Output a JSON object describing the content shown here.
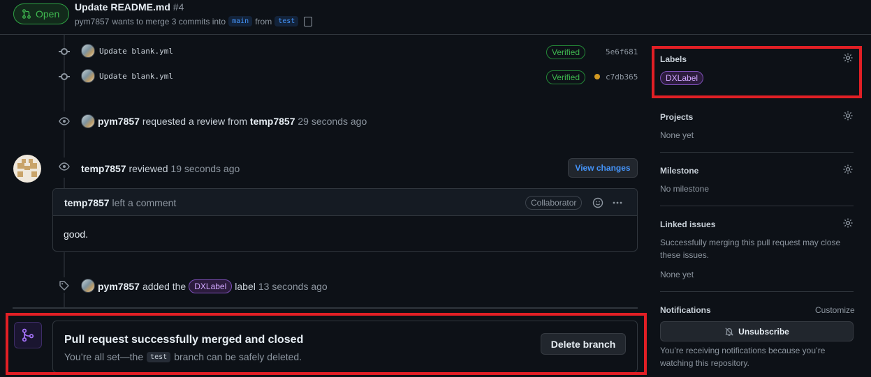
{
  "header": {
    "status": "Open",
    "title": "Update README.md",
    "number": "#4",
    "author": "pym7857",
    "merge_text": "wants to merge 3 commits into",
    "base_branch": "main",
    "from_text": "from",
    "head_branch": "test"
  },
  "commits": [
    {
      "message": "Update blank.yml",
      "badge": "Verified",
      "sha": "5e6f681"
    },
    {
      "message": "Update blank.yml",
      "badge": "Verified",
      "sha": "c7db365"
    }
  ],
  "events": {
    "review_request": {
      "actor": "pym7857",
      "text": "requested a review from",
      "target": "temp7857",
      "time": "29 seconds ago"
    },
    "review": {
      "actor": "temp7857",
      "text": "reviewed",
      "time": "19 seconds ago",
      "button": "View changes"
    },
    "comment": {
      "author": "temp7857",
      "action": "left a comment",
      "role": "Collaborator",
      "body": "good."
    },
    "label": {
      "actor": "pym7857",
      "text": "added the",
      "label": "DXLabel",
      "suffix": "label",
      "time": "13 seconds ago"
    }
  },
  "merge": {
    "title": "Pull request successfully merged and closed",
    "desc_prefix": "You’re all set—the",
    "branch": "test",
    "desc_suffix": "branch can be safely deleted.",
    "button": "Delete branch"
  },
  "sidebar": {
    "labels": {
      "title": "Labels",
      "value": "DXLabel"
    },
    "projects": {
      "title": "Projects",
      "value": "None yet"
    },
    "milestone": {
      "title": "Milestone",
      "value": "No milestone"
    },
    "linked": {
      "title": "Linked issues",
      "desc": "Successfully merging this pull request may close these issues.",
      "value": "None yet"
    },
    "notifications": {
      "title": "Notifications",
      "customize": "Customize",
      "button": "Unsubscribe",
      "desc": "You’re receiving notifications because you’re watching this repository."
    }
  },
  "colors": {
    "accent": "#4493f8",
    "success": "#3fb950",
    "label": "#d2a8ff",
    "highlight": "#e11f25"
  }
}
